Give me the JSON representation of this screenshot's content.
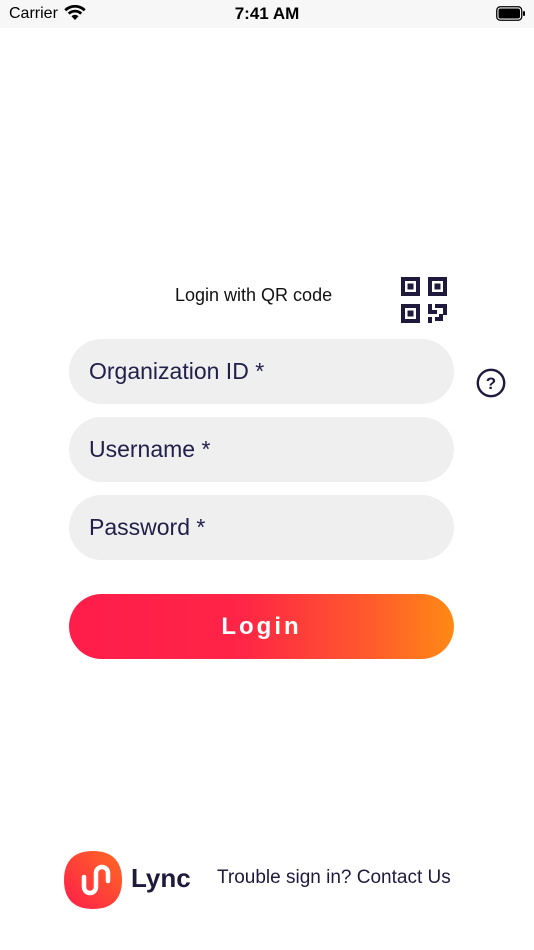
{
  "status_bar": {
    "carrier": "Carrier",
    "time": "7:41 AM"
  },
  "qr_login": {
    "label": "Login with QR code",
    "icon": "qr-code-icon"
  },
  "form": {
    "organization_id": {
      "value": "",
      "placeholder": "Organization ID *"
    },
    "username": {
      "value": "",
      "placeholder": "Username *"
    },
    "password": {
      "value": "",
      "placeholder": "Password *"
    },
    "help_icon": "question-circle-icon",
    "login_label": "Login"
  },
  "footer": {
    "logo_text": "Lync",
    "trouble_text": "Trouble sign in?",
    "contact_link": "Contact Us"
  },
  "colors": {
    "text_dark": "#1f1a3d",
    "field_bg": "#efefef",
    "button_gradient_start": "#ff1d4b",
    "button_gradient_end": "#ff8a15"
  }
}
